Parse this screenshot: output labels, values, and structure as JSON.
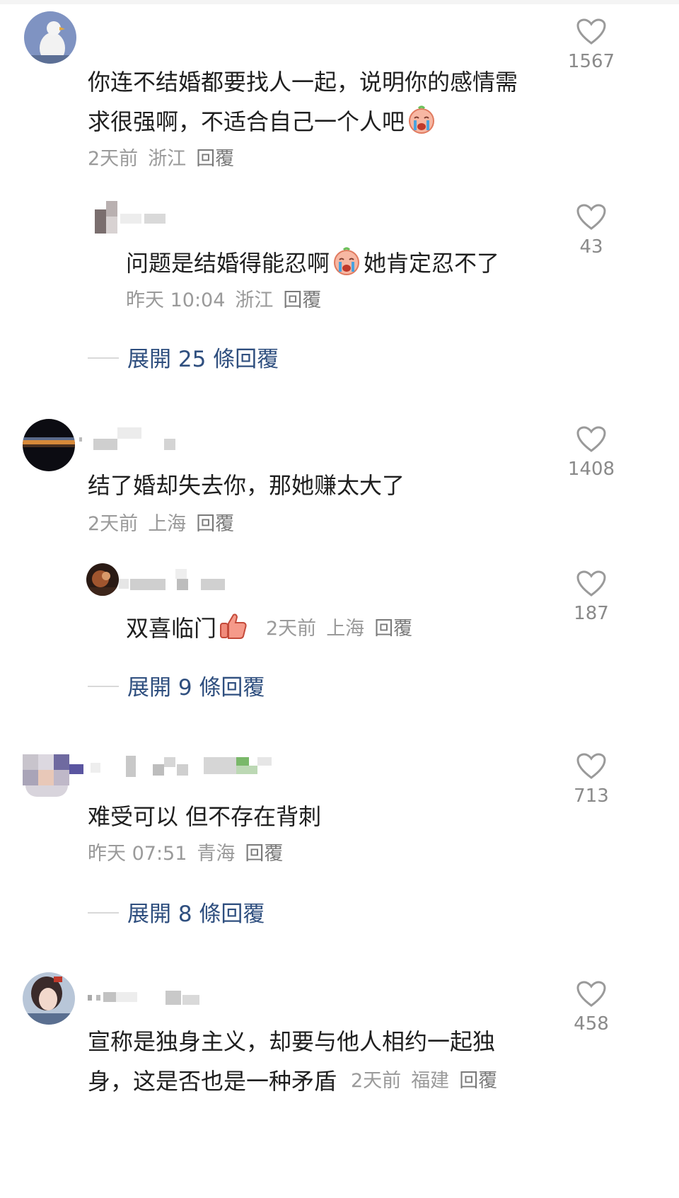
{
  "comments": [
    {
      "text_line1": "你连不结婚都要找人一起，说明你的感情需",
      "text_line2": "求很强啊，不适合自己一个人吧",
      "emoji": "crying-face",
      "time": "2天前",
      "location": "浙江",
      "reply": "回覆",
      "likes": "1567",
      "sub_reply": {
        "text_a": "问题是结婚得能忍啊",
        "emoji": "crying-face",
        "text_b": "她肯定忍不了",
        "time": "昨天 10:04",
        "location": "浙江",
        "reply": "回覆",
        "likes": "43"
      },
      "expand_label": "展開 25 條回覆"
    },
    {
      "text_line1": "结了婚却失去你，那她赚太大了",
      "time": "2天前",
      "location": "上海",
      "reply": "回覆",
      "likes": "1408",
      "sub_reply": {
        "text_a": "双喜临门",
        "emoji": "thumbs-up",
        "time": "2天前",
        "location": "上海",
        "reply": "回覆",
        "likes": "187"
      },
      "expand_label": "展開 9 條回覆"
    },
    {
      "text_line1": "难受可以 但不存在背刺",
      "time": "昨天 07:51",
      "location": "青海",
      "reply": "回覆",
      "likes": "713",
      "expand_label": "展開 8 條回覆"
    },
    {
      "text_line1": "宣称是独身主义，却要与他人相约一起独",
      "text_line2": "身，这是否也是一种矛盾",
      "time": "2天前",
      "location": "福建",
      "reply": "回覆",
      "likes": "458"
    }
  ],
  "icons": {
    "like": "heart-outline-icon"
  },
  "colors": {
    "expand_link": "#2f4f7f",
    "meta_text": "#9a9a9a"
  }
}
